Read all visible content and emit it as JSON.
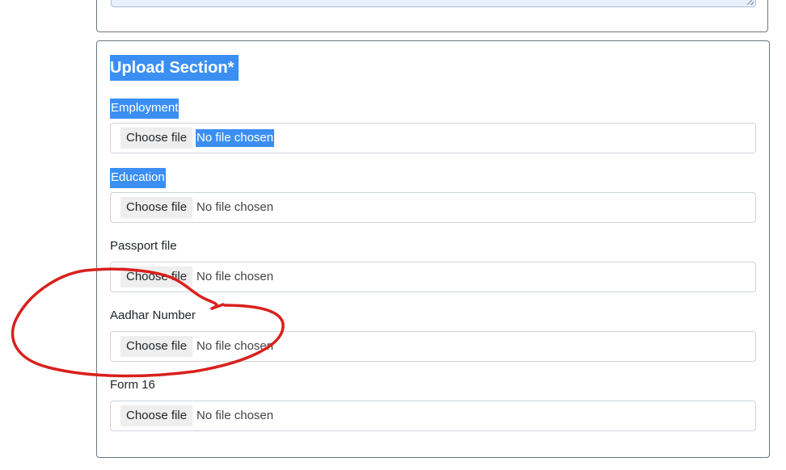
{
  "upload_section": {
    "title": "Upload Section",
    "required_marker": "*",
    "fields": [
      {
        "label": "Employment",
        "button": "Choose file",
        "status": "No file chosen"
      },
      {
        "label": "Education",
        "button": "Choose file",
        "status": "No file chosen"
      },
      {
        "label": "Passport file",
        "button": "Choose file",
        "status": "No file chosen"
      },
      {
        "label": "Aadhar Number",
        "button": "Choose file",
        "status": "No file chosen"
      },
      {
        "label": "Form 16",
        "button": "Choose file",
        "status": "No file chosen"
      }
    ]
  },
  "colors": {
    "selection_highlight": "#3b8ff3",
    "annotation_stroke": "#d9201c",
    "card_border": "#6c757d"
  }
}
